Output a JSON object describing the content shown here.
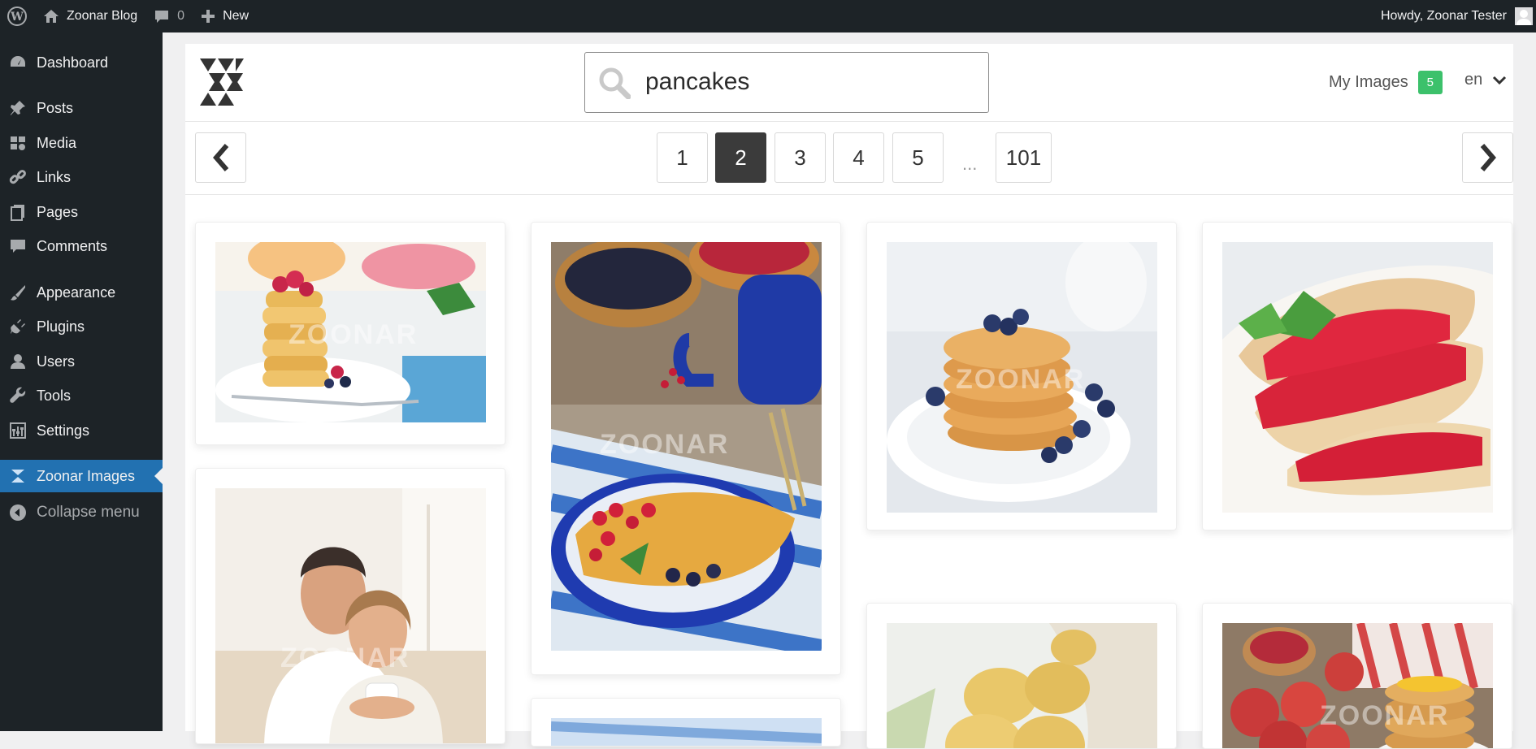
{
  "adminbar": {
    "site_name": "Zoonar Blog",
    "comments_count": "0",
    "new_label": "New",
    "howdy": "Howdy, Zoonar Tester"
  },
  "sidebar": {
    "items": [
      {
        "label": "Dashboard",
        "icon": "dashboard-icon"
      },
      {
        "label": "Posts",
        "icon": "pushpin-icon"
      },
      {
        "label": "Media",
        "icon": "media-icon"
      },
      {
        "label": "Links",
        "icon": "link-icon"
      },
      {
        "label": "Pages",
        "icon": "pages-icon"
      },
      {
        "label": "Comments",
        "icon": "comment-icon"
      },
      {
        "label": "Appearance",
        "icon": "brush-icon"
      },
      {
        "label": "Plugins",
        "icon": "plug-icon"
      },
      {
        "label": "Users",
        "icon": "user-icon"
      },
      {
        "label": "Tools",
        "icon": "wrench-icon"
      },
      {
        "label": "Settings",
        "icon": "settings-icon"
      },
      {
        "label": "Zoonar Images",
        "icon": "zoonar-icon"
      },
      {
        "label": "Collapse menu",
        "icon": "collapse-icon"
      }
    ],
    "active": "Zoonar Images"
  },
  "search": {
    "value": "pancakes"
  },
  "my_images": {
    "label": "My Images",
    "count": "5"
  },
  "language": {
    "selected": "en"
  },
  "pagination": {
    "pages": [
      "1",
      "2",
      "3",
      "4",
      "5"
    ],
    "current": "2",
    "ellipsis": "...",
    "last": "101"
  },
  "results": {
    "watermark": "ZOONAR",
    "images": [
      {
        "subject": "pancake stack with berries"
      },
      {
        "subject": "crepe with red currants and blueberries"
      },
      {
        "subject": "pancakes with blueberries"
      },
      {
        "subject": "crepes with strawberries"
      },
      {
        "subject": "smiling couple with cups"
      },
      {
        "subject": "potatoes in cloth sack"
      },
      {
        "subject": "pancakes with apples"
      },
      {
        "subject": "blue striped cloth"
      }
    ]
  },
  "colors": {
    "admin_dark": "#1d2327",
    "active_blue": "#2271b1",
    "badge_green": "#3cc16b",
    "current_page": "#3b3b3b"
  }
}
